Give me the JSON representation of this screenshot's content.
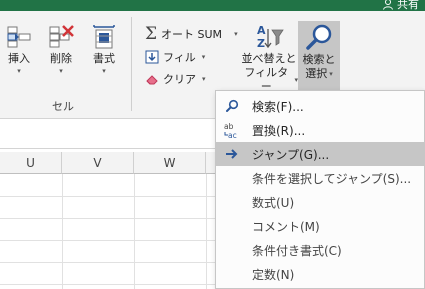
{
  "header": {
    "share_label": "共有"
  },
  "ribbon": {
    "cells_group": {
      "label": "セル",
      "insert_label": "挿入",
      "delete_label": "削除",
      "format_label": "書式"
    },
    "editing_group": {
      "autosum_label": "オート SUM",
      "fill_label": "フィル",
      "clear_label": "クリア",
      "sort_filter_label_1": "並べ替えと",
      "sort_filter_label_2": "フィルター",
      "find_select_label_1": "検索と",
      "find_select_label_2": "選択"
    }
  },
  "columns": [
    "U",
    "V",
    "W"
  ],
  "dropdown": {
    "items": [
      {
        "label": "検索(F)...",
        "icon": "magnifier-icon"
      },
      {
        "label": "置換(R)...",
        "icon": "replace-icon"
      },
      {
        "label": "ジャンプ(G)...",
        "icon": "arrow-right-icon",
        "highlighted": true
      },
      {
        "label": "条件を選択してジャンプ(S)...",
        "icon": ""
      },
      {
        "label": "数式(U)",
        "icon": ""
      },
      {
        "label": "コメント(M)",
        "icon": ""
      },
      {
        "label": "条件付き書式(C)",
        "icon": ""
      },
      {
        "label": "定数(N)",
        "icon": ""
      }
    ]
  },
  "colors": {
    "title_bar": "#217346",
    "ribbon_bg": "#f3f3f3",
    "menu_highlight": "#c6c6c6",
    "accent_blue": "#2b579a",
    "delete_red": "#d13438"
  }
}
